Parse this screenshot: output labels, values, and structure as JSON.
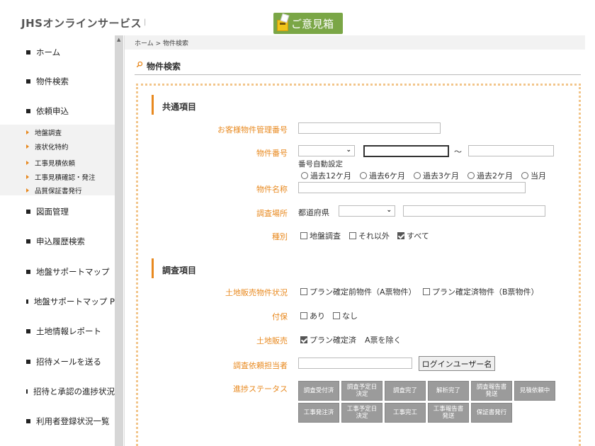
{
  "header": {
    "app_title": "JHSオンラインサービス",
    "separator": "|",
    "feedback_label": "ご意見箱"
  },
  "sidebar": {
    "items": [
      {
        "label": "ホーム"
      },
      {
        "label": "物件検索"
      },
      {
        "label": "依頼申込"
      },
      {
        "label": "図面管理"
      },
      {
        "label": "申込履歴検索"
      },
      {
        "label": "地盤サポートマップ"
      },
      {
        "label": "地盤サポートマップ P"
      },
      {
        "label": "土地情報レポート"
      },
      {
        "label": "招待メールを送る"
      },
      {
        "label": "招待と承認の進捗状況"
      },
      {
        "label": "利用者登録状況一覧"
      }
    ],
    "sub_items": [
      {
        "label": "地盤調査"
      },
      {
        "label": "液状化特約"
      },
      {
        "label": "工事見積依頼"
      },
      {
        "label": "工事見積確認・発注"
      },
      {
        "label": "品質保証書発行"
      }
    ]
  },
  "breadcrumb": {
    "home": "ホーム",
    "sep": ">",
    "current": "物件検索"
  },
  "page": {
    "title": "物件検索"
  },
  "common_section": {
    "heading": "共通項目",
    "customer_no_label": "お客様物件管理番号",
    "property_no_label": "物件番号",
    "range_sep": "〜",
    "auto_number_label": "番号自動設定",
    "period_options": [
      {
        "label": "過去12ケ月"
      },
      {
        "label": "過去6ケ月"
      },
      {
        "label": "過去3ケ月"
      },
      {
        "label": "過去2ケ月"
      },
      {
        "label": "当月"
      }
    ],
    "property_name_label": "物件名称",
    "location_label": "調査場所",
    "prefecture_label": "都道府県",
    "type_label": "種別",
    "type_options": [
      {
        "label": "地盤調査",
        "checked": false
      },
      {
        "label": "それ以外",
        "checked": false
      },
      {
        "label": "すべて",
        "checked": true
      }
    ]
  },
  "survey_section": {
    "heading": "調査項目",
    "land_sale_status_label": "土地販売物件状況",
    "land_sale_status_options": [
      {
        "label": "プラン確定前物件（A票物件）",
        "checked": false
      },
      {
        "label": "プラン確定済物件（B票物件）",
        "checked": false
      }
    ],
    "warranty_label": "付保",
    "warranty_options": [
      {
        "label": "あり",
        "checked": false
      },
      {
        "label": "なし",
        "checked": false
      }
    ],
    "land_sale_label": "土地販売",
    "land_sale_option": {
      "label": "プラン確定済",
      "checked": true
    },
    "land_sale_note": "A票を除く",
    "requester_label": "調査依頼担当者",
    "login_user_button": "ログインユーザー名",
    "progress_label": "進捗ステータス",
    "status_row1": [
      "調査受付済",
      "調査予定日\n決定",
      "調査完了",
      "解析完了",
      "調査報告書\n発送",
      "見積依頼中"
    ],
    "status_row2": [
      "工事発注済",
      "工事予定日\n決定",
      "工事完工",
      "工事報告書\n発送",
      "保証書発行"
    ]
  }
}
